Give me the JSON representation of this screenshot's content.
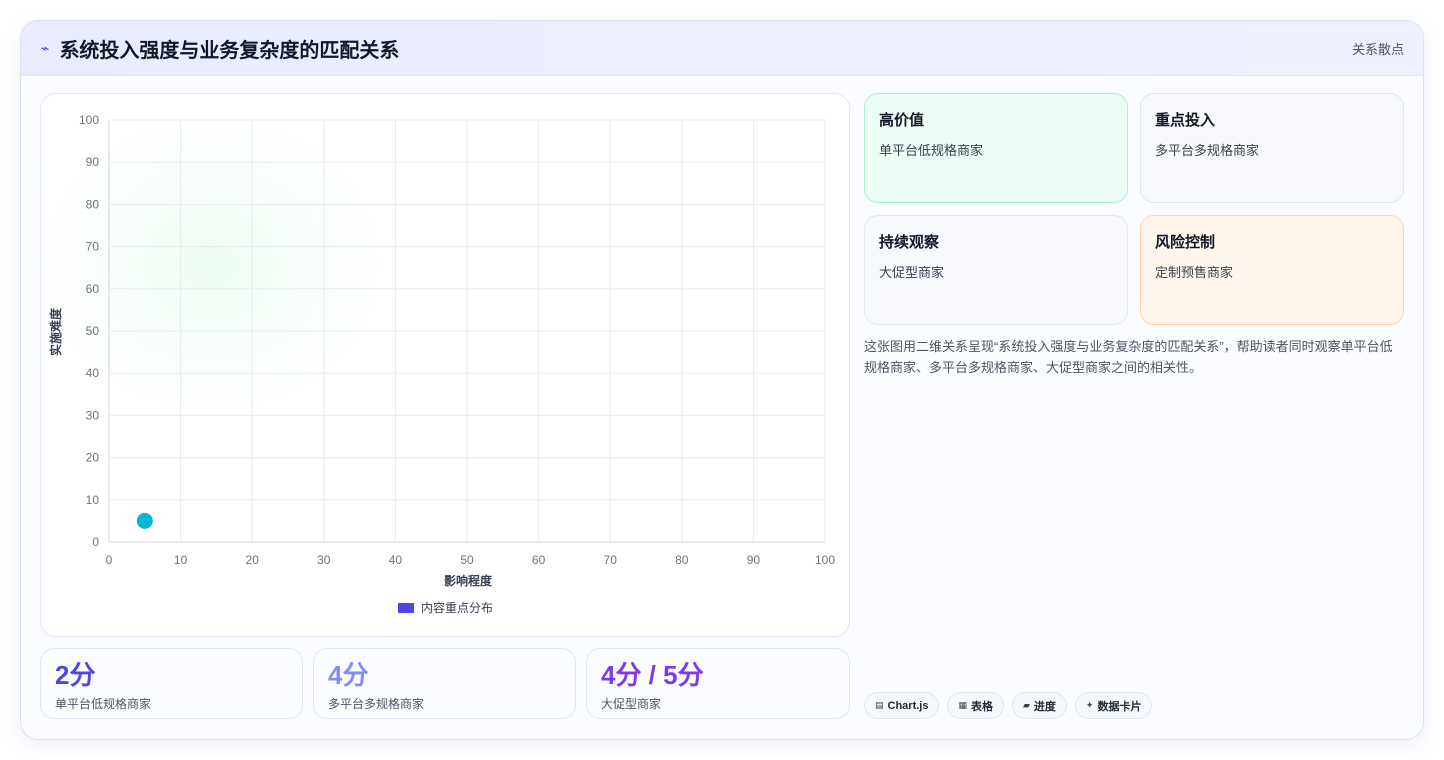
{
  "header": {
    "title": "系统投入强度与业务复杂度的匹配关系",
    "tag": "关系散点",
    "icon": "pulse-icon"
  },
  "chart_data": {
    "type": "scatter",
    "xlabel": "影响程度",
    "ylabel": "实施难度",
    "xlim": [
      0,
      100
    ],
    "ylim": [
      0,
      100
    ],
    "x_ticks": [
      0,
      10,
      20,
      30,
      40,
      50,
      60,
      70,
      80,
      90,
      100
    ],
    "y_ticks": [
      0,
      10,
      20,
      30,
      40,
      50,
      60,
      70,
      80,
      90,
      100
    ],
    "grid": true,
    "legend_position": "bottom",
    "series": [
      {
        "name": "内容重点分布",
        "legend_color": "#4f46e5",
        "point_color": "#06b6d4",
        "points": [
          {
            "x": 5,
            "y": 5
          }
        ]
      }
    ]
  },
  "stats": [
    {
      "value": "2分",
      "label": "单平台低规格商家",
      "color": "#4f46e5"
    },
    {
      "value": "4分",
      "label": "多平台多规格商家",
      "color": "#818cf8"
    },
    {
      "value": "4分 / 5分",
      "label": "大促型商家",
      "color": "#7c3aed"
    }
  ],
  "quadrants": [
    {
      "title": "高价值",
      "desc": "单平台低规格商家",
      "bg": "#ecfdf5",
      "border": "#a7f3d0"
    },
    {
      "title": "重点投入",
      "desc": "多平台多规格商家",
      "bg": "#f8f9fd",
      "border": "#e0e6f3"
    },
    {
      "title": "持续观察",
      "desc": "大促型商家",
      "bg": "#f8f9fd",
      "border": "#e0e6f3"
    },
    {
      "title": "风险控制",
      "desc": "定制预售商家",
      "bg": "#fff7ed",
      "border": "#fed7aa"
    }
  ],
  "summary": "这张图用二维关系呈现“系统投入强度与业务复杂度的匹配关系”，帮助读者同时观察单平台低规格商家、多平台多规格商家、大促型商家之间的相关性。",
  "pills": [
    {
      "icon": "▤",
      "label": "Chart.js"
    },
    {
      "icon": "▦",
      "label": "表格"
    },
    {
      "icon": "▰",
      "label": "进度"
    },
    {
      "icon": "✦",
      "label": "数据卡片"
    }
  ]
}
